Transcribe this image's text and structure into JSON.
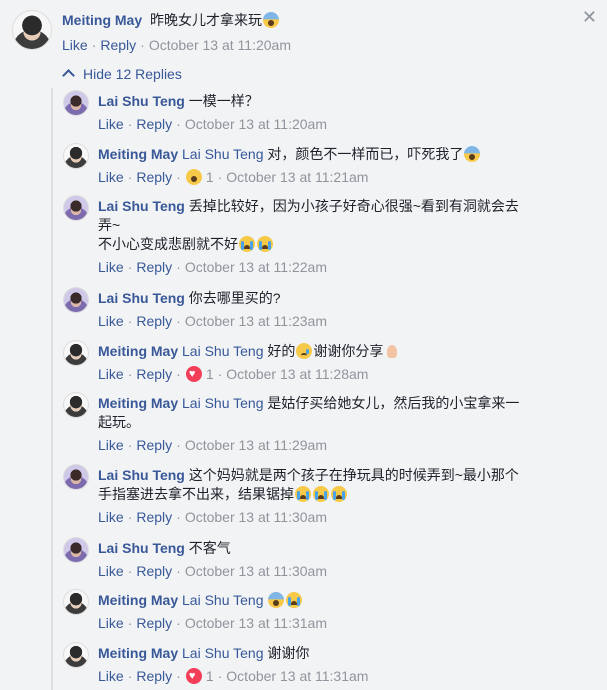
{
  "top_comment": {
    "author": "Meiting May",
    "text": "昨晚女儿才拿来玩",
    "emoji": "scream",
    "actions": {
      "like": "Like",
      "reply": "Reply",
      "time": "October 13 at 11:20am"
    }
  },
  "hide_replies_label": "Hide 12 Replies",
  "close_label": "✕",
  "replies": [
    {
      "author": "Lai Shu Teng",
      "avatar": "lai",
      "tag": "",
      "lines": [
        "一模一样？"
      ],
      "emojis": [],
      "reaction": null,
      "time": "October 13 at 11:20am"
    },
    {
      "author": "Meiting May",
      "avatar": "may",
      "tag": "Lai Shu Teng",
      "lines": [
        "对，颜色不一样而已，吓死我了"
      ],
      "emojis": [
        "scream"
      ],
      "reaction": {
        "icon": "wow",
        "count": "1"
      },
      "time": "October 13 at 11:21am"
    },
    {
      "author": "Lai Shu Teng",
      "avatar": "lai",
      "tag": "",
      "lines": [
        "丢掉比较好，因为小孩子好奇心很强~看到有洞就会去",
        "弄~",
        "不小心变成悲剧就不好"
      ],
      "emojis": [
        "sob",
        "sob"
      ],
      "reaction": null,
      "time": "October 13 at 11:22am"
    },
    {
      "author": "Lai Shu Teng",
      "avatar": "lai",
      "tag": "",
      "lines": [
        "你去哪里买的?"
      ],
      "emojis": [],
      "reaction": null,
      "time": "October 13 at 11:23am"
    },
    {
      "author": "Meiting May",
      "avatar": "may",
      "tag": "Lai Shu Teng",
      "lines": [
        "好的",
        "谢谢你分享"
      ],
      "emojis": [
        "cry",
        "pray"
      ],
      "reaction": {
        "icon": "heart",
        "count": "1"
      },
      "time": "October 13 at 11:28am"
    },
    {
      "author": "Meiting May",
      "avatar": "may",
      "tag": "Lai Shu Teng",
      "lines": [
        "是姑仔买给她女儿，然后我的小宝拿来一",
        "起玩。"
      ],
      "emojis": [],
      "reaction": null,
      "time": "October 13 at 11:29am"
    },
    {
      "author": "Lai Shu Teng",
      "avatar": "lai",
      "tag": "",
      "lines": [
        "这个妈妈就是两个孩子在挣玩具的时候弄到~最小那个",
        "手指塞进去拿不出来，结果锯掉"
      ],
      "emojis": [
        "sob",
        "sob",
        "sob"
      ],
      "reaction": null,
      "time": "October 13 at 11:30am"
    },
    {
      "author": "Lai Shu Teng",
      "avatar": "lai",
      "tag": "",
      "lines": [
        "不客气"
      ],
      "emojis": [],
      "reaction": null,
      "time": "October 13 at 11:30am"
    },
    {
      "author": "Meiting May",
      "avatar": "may",
      "tag": "Lai Shu Teng",
      "lines": [
        ""
      ],
      "emojis": [
        "scream",
        "sob"
      ],
      "reaction": null,
      "time": "October 13 at 11:31am"
    },
    {
      "author": "Meiting May",
      "avatar": "may",
      "tag": "Lai Shu Teng",
      "lines": [
        "谢谢你"
      ],
      "emojis": [],
      "reaction": {
        "icon": "heart",
        "count": "1"
      },
      "time": "October 13 at 11:31am"
    }
  ],
  "action_labels": {
    "like": "Like",
    "reply": "Reply"
  }
}
